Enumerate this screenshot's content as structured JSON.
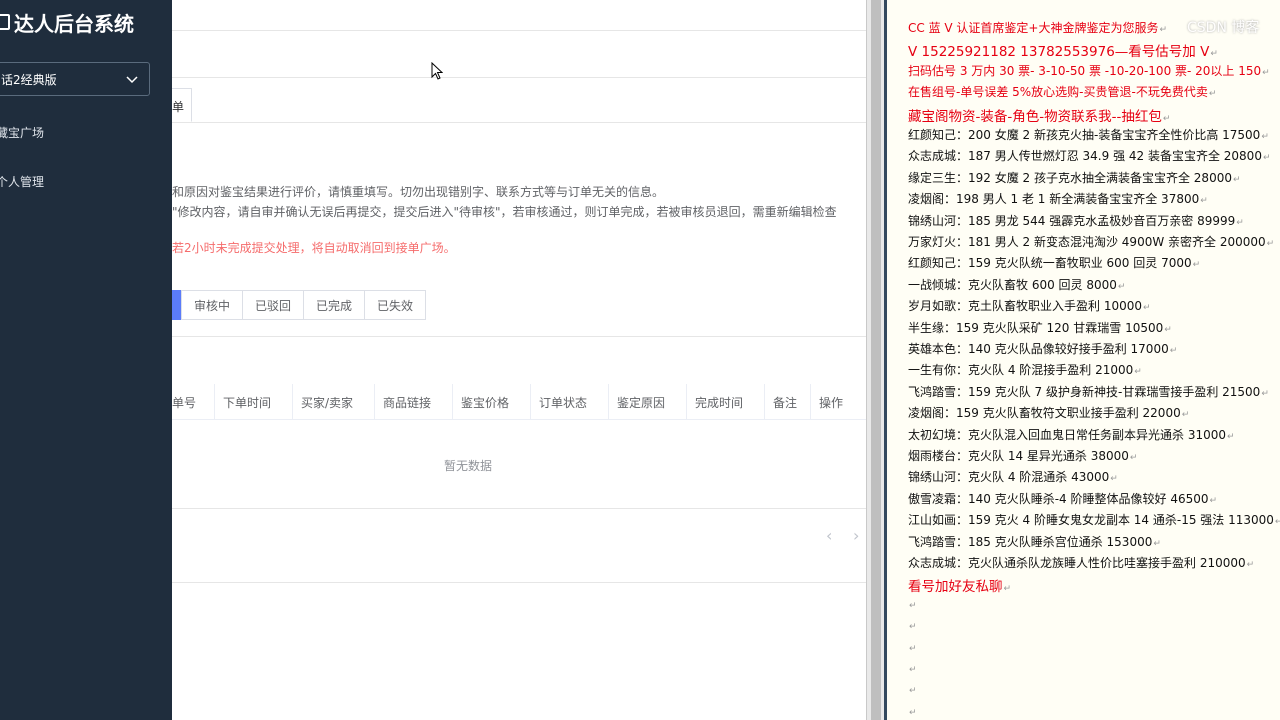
{
  "sidebar": {
    "title": "达人后台系统",
    "version_select": "话2经典版",
    "items": [
      {
        "label": "藏宝广场"
      },
      {
        "label": "个人管理"
      }
    ]
  },
  "main": {
    "tab_label": "单",
    "notices": [
      "和原因对鉴宝结果进行评价，请慎重填写。切勿出现错别字、联系方式等与订单无关的信息。",
      "\"修改内容，请自审并确认无误后再提交，提交后进入\"待审核\"，若审核通过，则订单完成，若被审核员退回，需重新编辑检查",
      "若2小时未完成提交处理，将自动取消回到接单广场。"
    ],
    "status_tabs": [
      "审核中",
      "已驳回",
      "已完成",
      "已失效"
    ],
    "columns": [
      "单号",
      "下单时间",
      "买家/卖家",
      "商品链接",
      "鉴宝价格",
      "订单状态",
      "鉴定原因",
      "完成时间",
      "备注",
      "操作"
    ],
    "empty_text": "暂无数据",
    "pager_prev": "‹",
    "pager_next": "›"
  },
  "doc": {
    "watermark": "CSDN 博客",
    "lines": [
      {
        "text": "CC 蓝 V 认证首席鉴定+大神金牌鉴定为您服务",
        "red": true
      },
      {
        "text": "V 15225921182     13782553976—看号估号加 V",
        "red": true,
        "big": true
      },
      {
        "text": "扫码估号 3 万内 30 票- 3-10-50 票  -10-20-100 票- 20以上 150",
        "red": true
      },
      {
        "text": "在售组号-单号误差 5%放心选购-买贵管退-不玩免费代卖",
        "red": true
      },
      {
        "text": "藏宝阁物资-装备-角色-物资联系我--抽红包",
        "red": true,
        "big": true
      },
      {
        "text": "红颜知己：200 女魔 2 新孩克火抽-装备宝宝齐全性价比高 17500"
      },
      {
        "text": "众志成城：187 男人传世燃灯忍 34.9 强 42 装备宝宝齐全 20800"
      },
      {
        "text": "缘定三生：192 女魔 2 孩子克水抽全满装备宝宝齐全 28000"
      },
      {
        "text": "凌烟阁：198 男人 1 老 1 新全满装备宝宝齐全 37800"
      },
      {
        "text": "锦绣山河：185 男龙 544 强霹克水孟极妙音百万亲密 89999"
      },
      {
        "text": "万家灯火：181 男人 2 新变态混沌淘沙 4900W 亲密齐全 200000"
      },
      {
        "text": "红颜知己：159 克火队统一畜牧职业 600 回灵 7000"
      },
      {
        "text": "一战倾城：克火队畜牧 600 回灵 8000"
      },
      {
        "text": "岁月如歌：克土队畜牧职业入手盈利 10000"
      },
      {
        "text": "半生缘：159 克火队采矿 120 甘霖瑞雪 10500"
      },
      {
        "text": "英雄本色：140 克火队品像较好接手盈利 17000"
      },
      {
        "text": "一生有你：克火队 4 阶混接手盈利 21000"
      },
      {
        "text": "飞鸿踏雪：159 克火队 7 级护身新神技-甘霖瑞雪接手盈利 21500"
      },
      {
        "text": "凌烟阁：159 克火队畜牧符文职业接手盈利 22000"
      },
      {
        "text": "太初幻境：克火队混入回血鬼日常任务副本异光通杀 31000"
      },
      {
        "text": "烟雨楼台：克火队 14 星异光通杀 38000"
      },
      {
        "text": "锦绣山河：克火队 4 阶混通杀 43000"
      },
      {
        "text": "傲雪凌霜：140 克火队睡杀-4 阶睡整体品像较好 46500"
      },
      {
        "text": "江山如画：159 克火 4 阶睡女鬼女龙副本 14 通杀-15 强法 113000"
      },
      {
        "text": "飞鸿踏雪：185 克火队睡杀宫位通杀 153000"
      },
      {
        "text": "众志成城：克火队通杀队龙族睡人性价比哇塞接手盈利 210000"
      },
      {
        "text": "看号加好友私聊",
        "red": true,
        "big": true
      },
      {
        "text": ""
      },
      {
        "text": ""
      },
      {
        "text": ""
      },
      {
        "text": ""
      },
      {
        "text": ""
      },
      {
        "text": ""
      }
    ],
    "para_mark": "↵"
  },
  "colors": {
    "sidebar_bg": "#1f2d3d",
    "accent": "#5b7cfa",
    "warning": "#f56c6c",
    "doc_red": "#e60012"
  }
}
